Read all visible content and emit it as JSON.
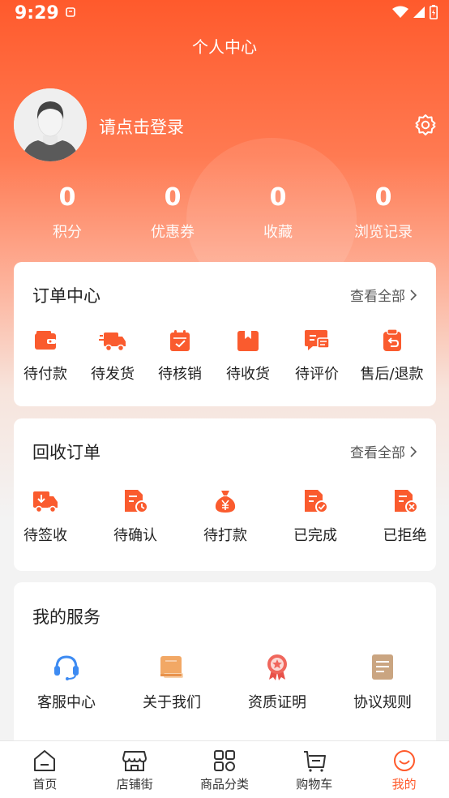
{
  "status_bar": {
    "time": "9:29"
  },
  "header": {
    "title": "个人中心"
  },
  "profile": {
    "login_prompt": "请点击登录"
  },
  "stats": [
    {
      "value": "0",
      "label": "积分"
    },
    {
      "value": "0",
      "label": "优惠券"
    },
    {
      "value": "0",
      "label": "收藏"
    },
    {
      "value": "0",
      "label": "浏览记录"
    }
  ],
  "order_center": {
    "title": "订单中心",
    "view_all": "查看全部",
    "items": [
      {
        "label": "待付款",
        "icon": "wallet-icon"
      },
      {
        "label": "待发货",
        "icon": "truck-icon"
      },
      {
        "label": "待核销",
        "icon": "calendar-check-icon"
      },
      {
        "label": "待收货",
        "icon": "package-icon"
      },
      {
        "label": "待评价",
        "icon": "comment-icon"
      },
      {
        "label": "售后/退款",
        "icon": "refund-icon"
      }
    ]
  },
  "recycle_orders": {
    "title": "回收订单",
    "view_all": "查看全部",
    "items": [
      {
        "label": "待签收",
        "icon": "delivery-truck-icon"
      },
      {
        "label": "待确认",
        "icon": "document-clock-icon"
      },
      {
        "label": "待打款",
        "icon": "money-bag-icon"
      },
      {
        "label": "已完成",
        "icon": "document-check-icon"
      },
      {
        "label": "已拒绝",
        "icon": "document-reject-icon"
      }
    ]
  },
  "services": {
    "title": "我的服务",
    "items": [
      {
        "label": "客服中心",
        "icon": "headset-icon"
      },
      {
        "label": "关于我们",
        "icon": "book-icon"
      },
      {
        "label": "资质证明",
        "icon": "award-icon"
      },
      {
        "label": "协议规则",
        "icon": "agreement-icon"
      }
    ]
  },
  "tabbar": {
    "items": [
      {
        "label": "首页",
        "icon": "home-icon"
      },
      {
        "label": "店铺街",
        "icon": "store-icon"
      },
      {
        "label": "商品分类",
        "icon": "category-icon"
      },
      {
        "label": "购物车",
        "icon": "cart-icon"
      },
      {
        "label": "我的",
        "icon": "smile-icon"
      }
    ],
    "active_index": 4
  },
  "colors": {
    "accent": "#ff5a2c",
    "icon_orange": "#fa5b2e"
  }
}
